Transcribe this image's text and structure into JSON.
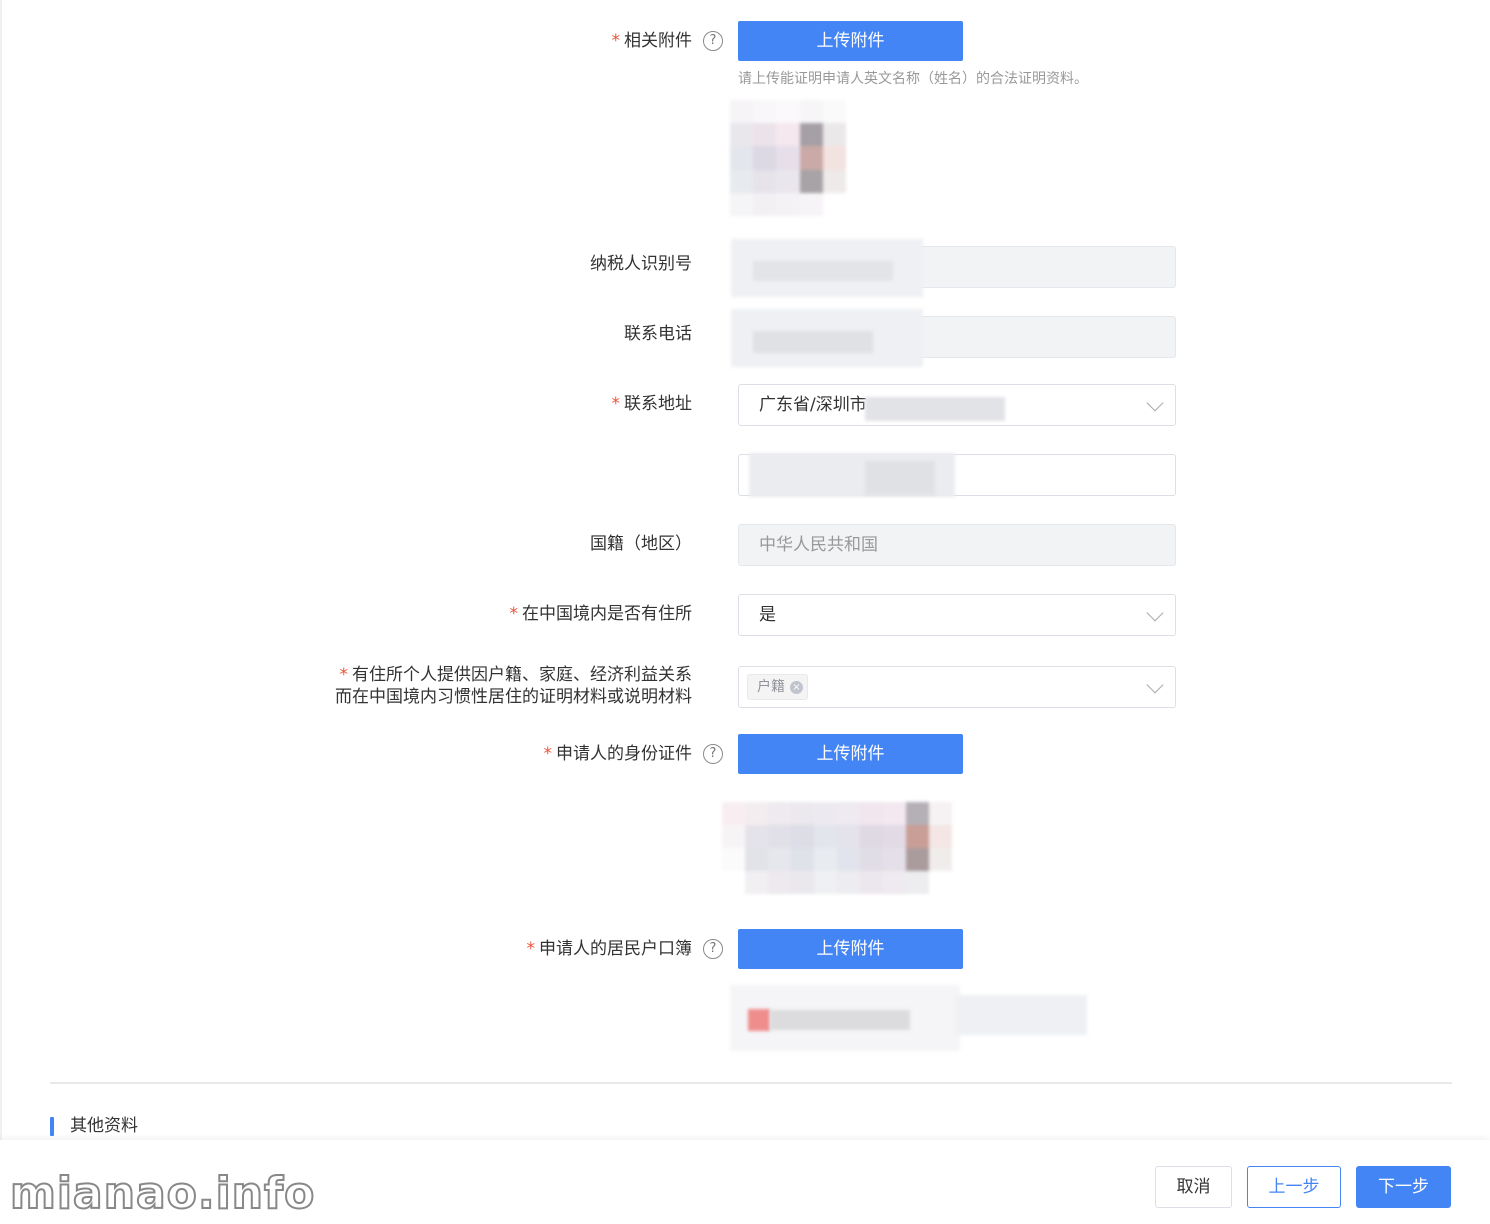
{
  "form": {
    "attachment": {
      "label": "相关附件",
      "required": true,
      "help": "?",
      "upload_label": "上传附件",
      "hint": "请上传能证明申请人英文名称（姓名）的合法证明资料。"
    },
    "tax_id": {
      "label": "纳税人识别号",
      "required": false
    },
    "phone": {
      "label": "联系电话",
      "required": false
    },
    "address": {
      "label": "联系地址",
      "required": true,
      "region_value": "广东省/深圳市"
    },
    "nationality": {
      "label": "国籍（地区）",
      "value": "中华人民共和国"
    },
    "domicile": {
      "label": "在中国境内是否有住所",
      "required": true,
      "value": "是"
    },
    "domicile_proof": {
      "label_line1": "有住所个人提供因户籍、家庭、经济利益关系",
      "label_line2": "而在中国境内习惯性居住的证明材料或说明材料",
      "required": true,
      "tag": "户籍",
      "tag_close": "×"
    },
    "id_document": {
      "label": "申请人的身份证件",
      "required": true,
      "help": "?",
      "upload_label": "上传附件"
    },
    "household_register": {
      "label": "申请人的居民户口簿",
      "required": true,
      "help": "?",
      "upload_label": "上传附件"
    },
    "required_mark": "*"
  },
  "section": {
    "title": "其他资料"
  },
  "footer": {
    "watermark": "mianao.info",
    "cancel_label": "取消",
    "prev_label": "上一步",
    "next_label": "下一步"
  },
  "colors": {
    "primary": "#4385f5",
    "required": "#e8553c",
    "hint": "#999999"
  }
}
